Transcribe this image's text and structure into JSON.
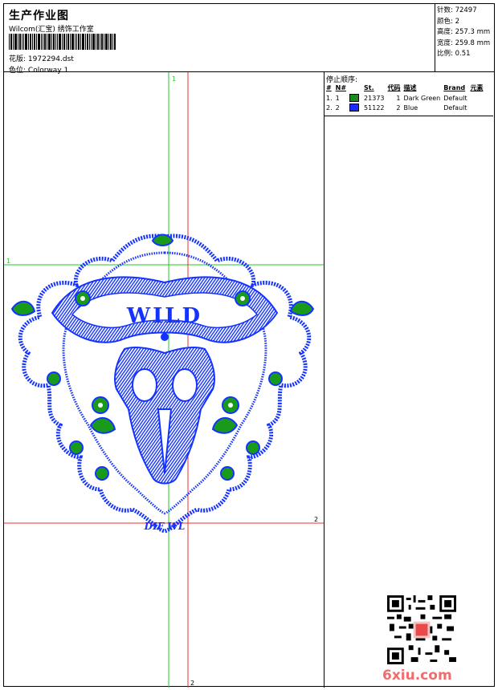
{
  "header": {
    "title": "生产作业图",
    "company": "Wilcom(汇宝) 绣饰工作室",
    "design_label": "花版:",
    "design_value": "1972294.dst",
    "colorway_label": "色位:",
    "colorway_value": "Colorway 1"
  },
  "stats": [
    {
      "label": "针数:",
      "value": "72497"
    },
    {
      "label": "颜色:",
      "value": "2"
    },
    {
      "label": "高度:",
      "value": "257.3 mm"
    },
    {
      "label": "宽度:",
      "value": "259.8 mm"
    },
    {
      "label": "比例:",
      "value": "0.51"
    }
  ],
  "stop_sequence": {
    "title": "停止顺序:",
    "columns": [
      "#",
      "N#",
      "St.",
      "代码",
      "描述",
      "Brand",
      "元素"
    ],
    "rows": [
      {
        "num": "1.",
        "n": "1",
        "code": "21373",
        "st": "1",
        "desc": "Dark Green",
        "brand": "Default",
        "color": "#1a8a1a"
      },
      {
        "num": "2.",
        "n": "2",
        "code": "51122",
        "st": "2",
        "desc": "Blue",
        "brand": "Default",
        "color": "#1a2bff"
      }
    ]
  },
  "canvas": {
    "markers": {
      "green_top": "1",
      "green_left": "1",
      "red_right": "2",
      "red_bottom": "2"
    },
    "lettering_top": "WILD",
    "lettering_bottom": "DIF WL",
    "colors": {
      "blue": "#1433ff",
      "green": "#1a9a1a",
      "guide_green": "#22cc22",
      "guide_red": "#e83030"
    }
  },
  "watermark": "6xiu.com"
}
